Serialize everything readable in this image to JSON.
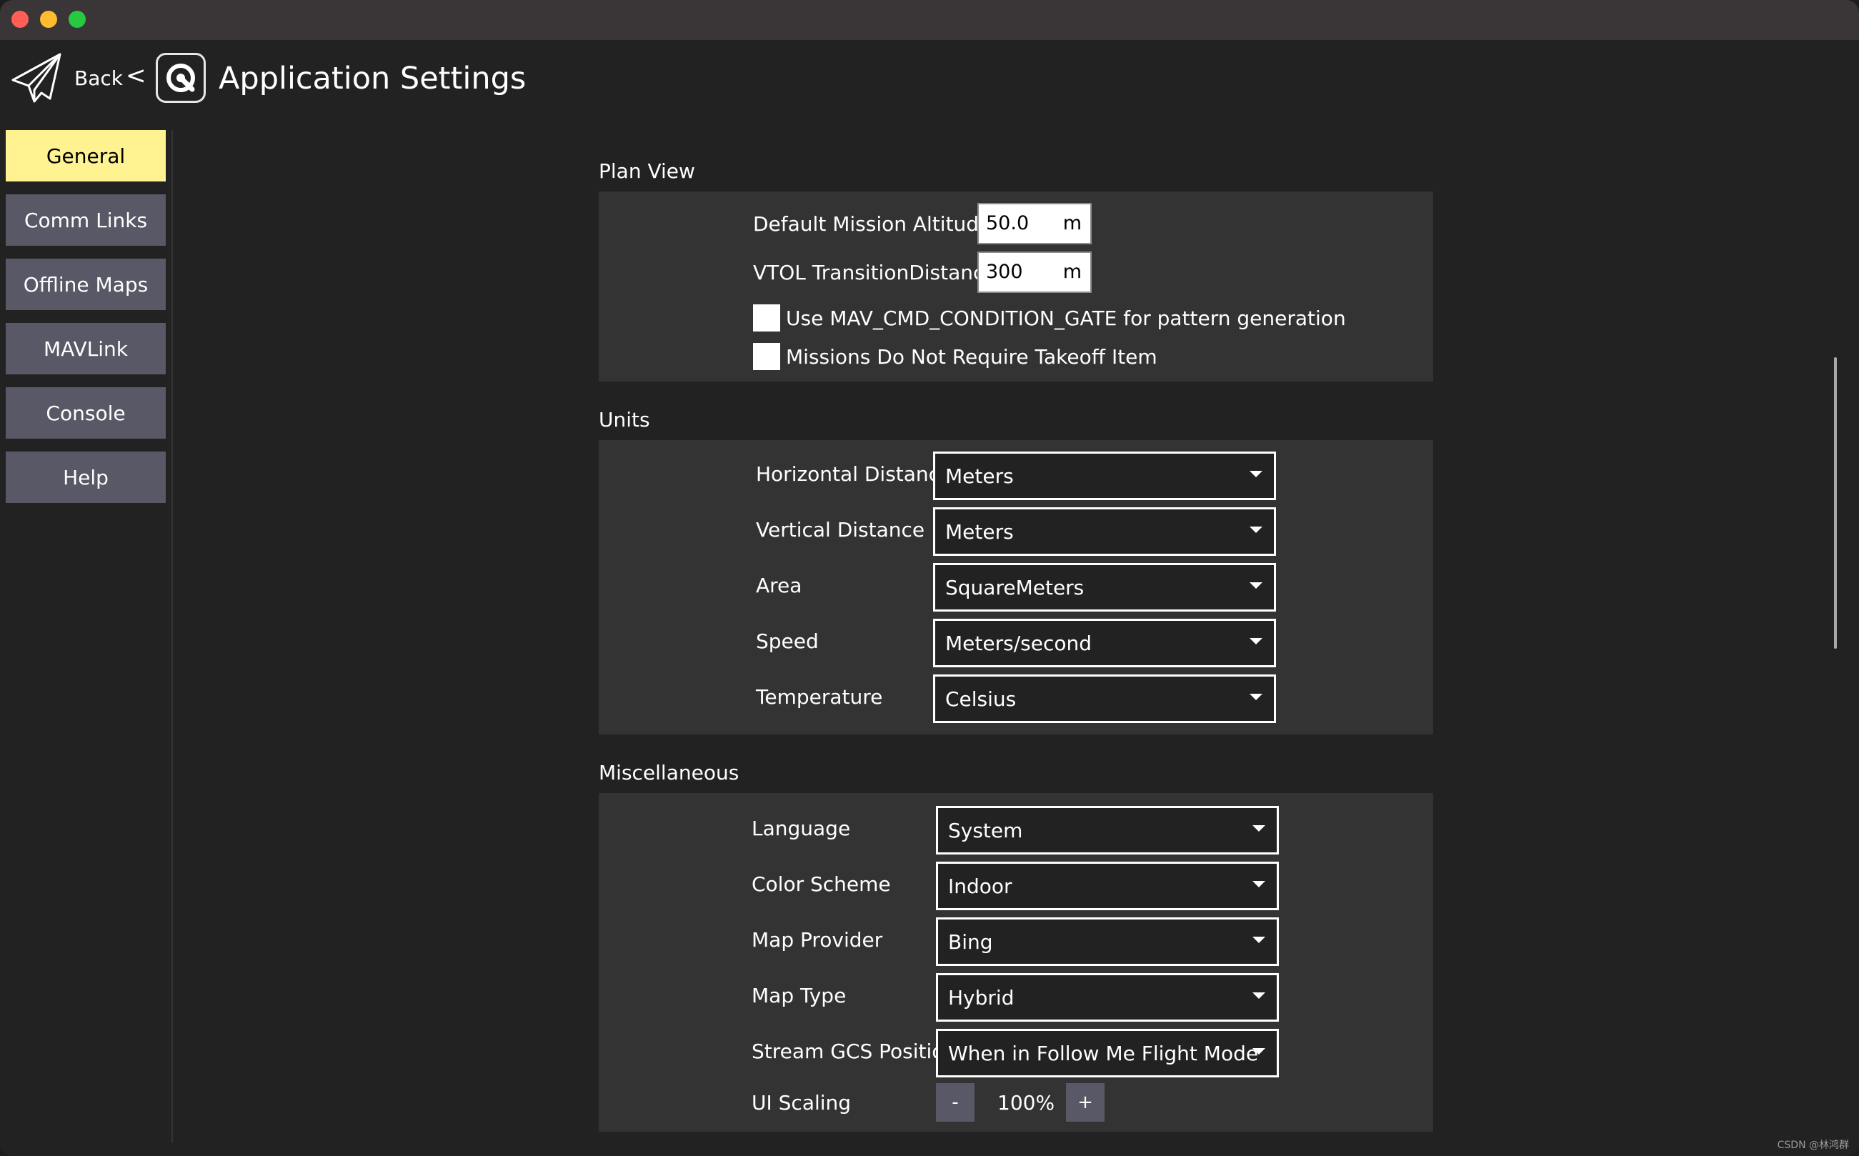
{
  "header": {
    "back_label": "Back",
    "back_arrow": "<",
    "title": "Application Settings"
  },
  "sidebar": {
    "items": [
      {
        "label": "General",
        "active": true
      },
      {
        "label": "Comm Links"
      },
      {
        "label": "Offline Maps"
      },
      {
        "label": "MAVLink"
      },
      {
        "label": "Console"
      },
      {
        "label": "Help"
      }
    ]
  },
  "plan_view": {
    "title": "Plan View",
    "altitude": {
      "label": "Default Mission Altitude",
      "value": "50.0",
      "unit": "m"
    },
    "vtol": {
      "label": "VTOL TransitionDistance",
      "value": "300",
      "unit": "m"
    },
    "gate_checkbox": {
      "label": "Use MAV_CMD_CONDITION_GATE for pattern generation",
      "checked": false
    },
    "takeoff_checkbox": {
      "label": "Missions Do Not Require Takeoff Item",
      "checked": false
    }
  },
  "units": {
    "title": "Units",
    "rows": [
      {
        "label": "Horizontal Distance",
        "value": "Meters"
      },
      {
        "label": "Vertical Distance",
        "value": "Meters"
      },
      {
        "label": "Area",
        "value": "SquareMeters"
      },
      {
        "label": "Speed",
        "value": "Meters/second"
      },
      {
        "label": "Temperature",
        "value": "Celsius"
      }
    ]
  },
  "misc": {
    "title": "Miscellaneous",
    "rows": [
      {
        "label": "Language",
        "value": "System"
      },
      {
        "label": "Color Scheme",
        "value": "Indoor"
      },
      {
        "label": "Map Provider",
        "value": "Bing"
      },
      {
        "label": "Map Type",
        "value": "Hybrid"
      },
      {
        "label": "Stream GCS Position",
        "value": "When in Follow Me Flight Mode"
      }
    ],
    "ui_scaling": {
      "label": "UI Scaling",
      "value": "100%",
      "minus": "-",
      "plus": "+"
    }
  },
  "watermark": "CSDN @林鸿群",
  "colors": {
    "active_tab": "#fff291",
    "tab": "#585866",
    "panel": "#333333",
    "background": "#222222"
  },
  "icons": [
    "plane-icon",
    "qgc-logo-icon",
    "dropdown-caret-icon"
  ]
}
